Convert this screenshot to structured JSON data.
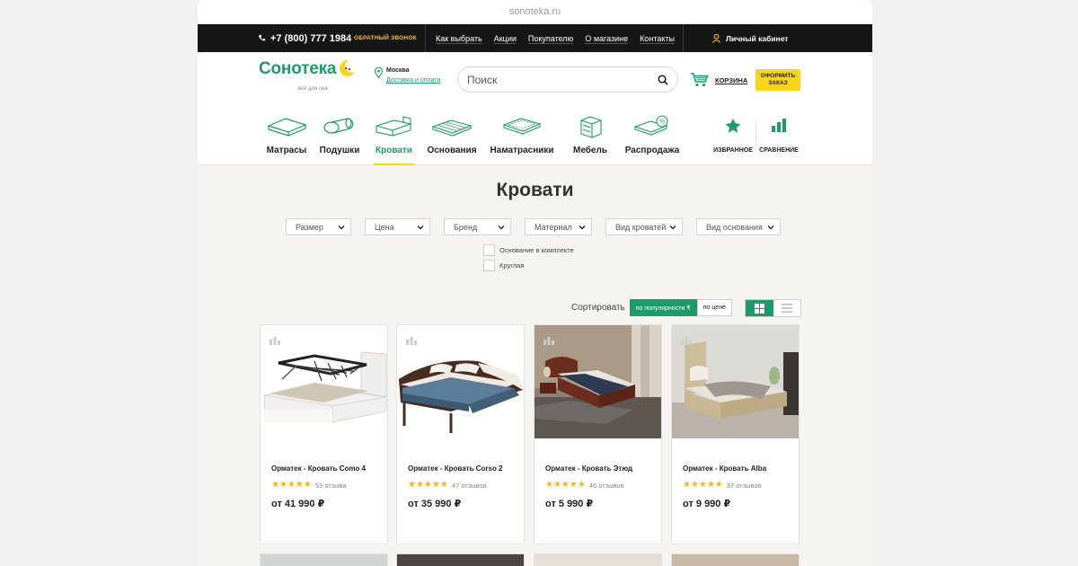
{
  "browser": {
    "url": "sonoteka.ru"
  },
  "topbar": {
    "phone": "+7 (800) 777 1984",
    "callback": "ОБРАТНЫЙ ЗВОНОК",
    "nav": [
      "Как выбрать",
      "Акции",
      "Покупателю",
      "О магазине",
      "Контакты"
    ],
    "account": "Личный кабинет"
  },
  "header": {
    "logo": "Сонотека",
    "tagline": "всё для сна",
    "city": "Москва",
    "delivery": "Доставка и оплата",
    "search_placeholder": "Поиск",
    "cart": "КОРЗИНА",
    "order": "ОФОРМИТЬ ЗАКАЗ"
  },
  "categories": [
    {
      "label": "Матрасы",
      "icon": "mattress-icon"
    },
    {
      "label": "Подушки",
      "icon": "pillow-icon"
    },
    {
      "label": "Кровати",
      "icon": "bed-icon",
      "active": true
    },
    {
      "label": "Основания",
      "icon": "bed-base-icon"
    },
    {
      "label": "Наматрасники",
      "icon": "mattress-topper-icon"
    },
    {
      "label": "Мебель",
      "icon": "furniture-icon"
    },
    {
      "label": "Распродажа",
      "icon": "sale-icon"
    }
  ],
  "quick": {
    "favorites": "ИЗБРАННОЕ",
    "compare": "СРАВНЕНИЕ"
  },
  "page": {
    "title": "Кровати"
  },
  "filters": [
    "Размер",
    "Цена",
    "Бренд",
    "Материал",
    "Вид кроватей",
    "Вид основания"
  ],
  "checkboxes": [
    "Основание в комплекте",
    "Круглая"
  ],
  "sort": {
    "label": "Сортировать",
    "popular": "по популярности ₹",
    "price": "по цене"
  },
  "products": [
    {
      "title": "Орматек - Кровать Como 4",
      "reviews": "53 отзыва",
      "price": "от 41 990 ₽",
      "stars": 5
    },
    {
      "title": "Орматек - Кровать Corso 2",
      "reviews": "47 отзывов",
      "price": "от 35 990 ₽",
      "stars": 5
    },
    {
      "title": "Орматек - Кровать Этюд",
      "reviews": "46 отзывов",
      "price": "от 5 990 ₽",
      "stars": 5
    },
    {
      "title": "Орматек - Кровать Alba",
      "reviews": "37 отзывов",
      "price": "от 9 990 ₽",
      "stars": 5
    }
  ],
  "colors": {
    "brand": "#1e9a6b",
    "accent": "#f8d41b",
    "star": "#f3b718",
    "topbar": "#161616"
  }
}
